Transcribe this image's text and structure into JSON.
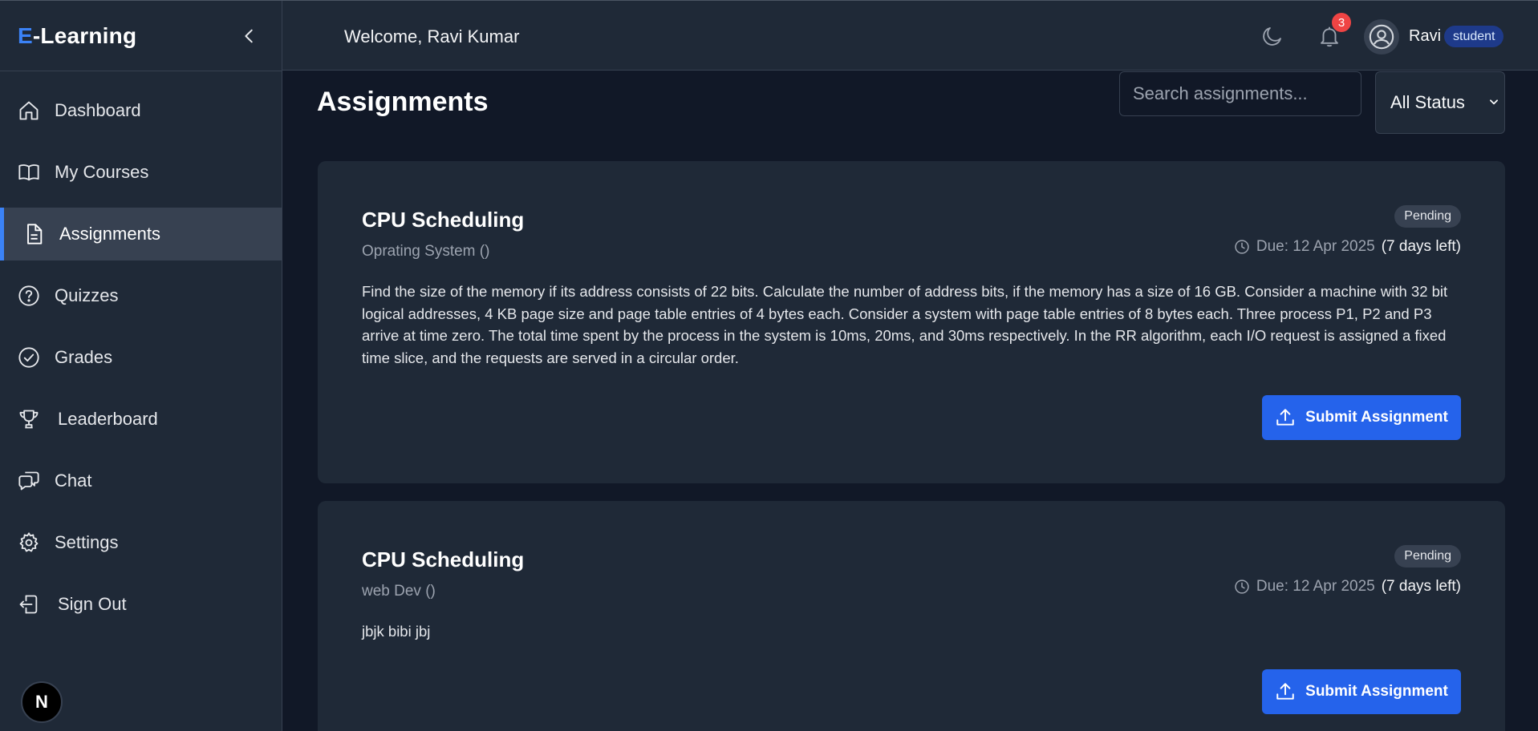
{
  "brand": {
    "prefix": "E",
    "rest": "-Learning"
  },
  "sidebar": {
    "items": [
      {
        "label": "Dashboard",
        "icon": "home-icon"
      },
      {
        "label": "My Courses",
        "icon": "book-icon"
      },
      {
        "label": "Assignments",
        "icon": "document-icon",
        "active": true
      },
      {
        "label": "Quizzes",
        "icon": "question-icon"
      },
      {
        "label": "Grades",
        "icon": "check-circle-icon"
      },
      {
        "label": "Leaderboard",
        "icon": "trophy-icon"
      },
      {
        "label": "Chat",
        "icon": "chat-icon"
      },
      {
        "label": "Settings",
        "icon": "gear-icon"
      },
      {
        "label": "Sign Out",
        "icon": "sign-out-icon"
      }
    ],
    "bottom_badge": "N"
  },
  "header": {
    "welcome": "Welcome, Ravi Kumar",
    "notification_count": "3",
    "user_name": "Ravi",
    "role": "student"
  },
  "main": {
    "title": "Assignments",
    "search_placeholder": "Search assignments...",
    "status_filter": "All Status"
  },
  "assignments": [
    {
      "title": "CPU Scheduling",
      "course": "Oprating System ()",
      "status": "Pending",
      "due": "Due: 12 Apr 2025",
      "days_left": "(7 days left)",
      "description": "Find the size of the memory if its address consists of 22 bits. Calculate the number of address bits, if the memory has a size of 16 GB. Consider a machine with 32 bit logical addresses, 4 KB page size and page table entries of 4 bytes each. Consider a system with page table entries of 8 bytes each. Three process P1, P2 and P3 arrive at time zero. The total time spent by the process in the system is 10ms, 20ms, and 30ms respectively. In the RR algorithm, each I/O request is assigned a fixed time slice, and the requests are served in a circular order.",
      "submit_label": "Submit Assignment"
    },
    {
      "title": "CPU Scheduling",
      "course": "web Dev ()",
      "status": "Pending",
      "due": "Due: 12 Apr 2025",
      "days_left": "(7 days left)",
      "description": "jbjk bibi jbj",
      "submit_label": "Submit Assignment"
    }
  ],
  "colors": {
    "accent": "#3b82f6",
    "button": "#2563eb",
    "background": "#111827",
    "panel": "#1f2937",
    "badge_red": "#ef4444"
  }
}
